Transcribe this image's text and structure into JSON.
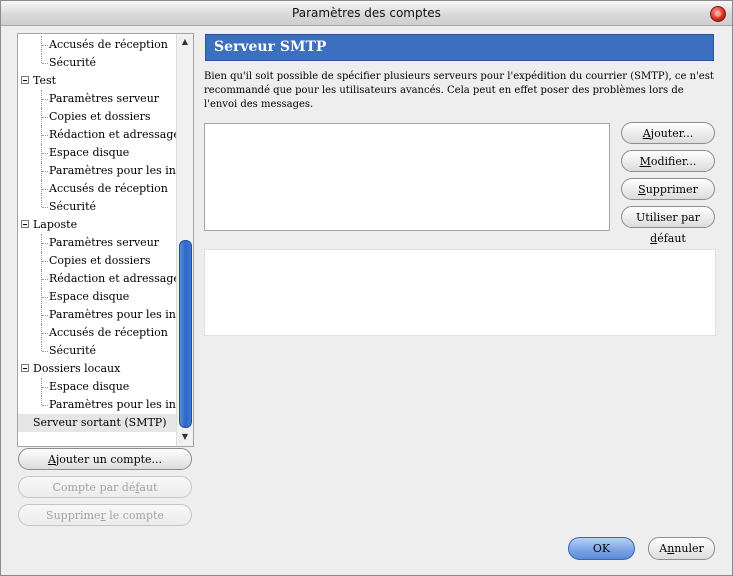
{
  "window": {
    "title": "Paramètres des comptes"
  },
  "tree": {
    "items": [
      {
        "label": "Accusés de réception",
        "level": 1
      },
      {
        "label": "Sécurité",
        "level": 1
      },
      {
        "label": "Test",
        "level": 0
      },
      {
        "label": "Paramètres serveur",
        "level": 1
      },
      {
        "label": "Copies et dossiers",
        "level": 1
      },
      {
        "label": "Rédaction et adressage",
        "level": 1
      },
      {
        "label": "Espace disque",
        "level": 1
      },
      {
        "label": "Paramètres pour les indé...",
        "level": 1
      },
      {
        "label": "Accusés de réception",
        "level": 1
      },
      {
        "label": "Sécurité",
        "level": 1
      },
      {
        "label": "Laposte",
        "level": 0
      },
      {
        "label": "Paramètres serveur",
        "level": 1
      },
      {
        "label": "Copies et dossiers",
        "level": 1
      },
      {
        "label": "Rédaction et adressage",
        "level": 1
      },
      {
        "label": "Espace disque",
        "level": 1
      },
      {
        "label": "Paramètres pour les indé...",
        "level": 1
      },
      {
        "label": "Accusés de réception",
        "level": 1
      },
      {
        "label": "Sécurité",
        "level": 1
      },
      {
        "label": "Dossiers locaux",
        "level": 0
      },
      {
        "label": "Espace disque",
        "level": 1
      },
      {
        "label": "Paramètres pour les indé...",
        "level": 1
      },
      {
        "label": "Serveur sortant (SMTP)",
        "level": 0,
        "selected": true
      }
    ]
  },
  "left_buttons": {
    "add_account": {
      "pre": "",
      "key": "A",
      "post": "jouter un compte..."
    },
    "default_account": {
      "pre": "Compte par dé",
      "key": "f",
      "post": "aut"
    },
    "delete_account": {
      "pre": "Supprime",
      "key": "r",
      "post": " le compte"
    }
  },
  "main": {
    "section_title": "Serveur SMTP",
    "description": "Bien qu'il soit possible de spécifier plusieurs serveurs pour l'expédition du courrier (SMTP), ce n'est recommandé que pour les utilisateurs avancés. Cela peut en effet poser des problèmes lors de l'envoi des messages."
  },
  "right_buttons": {
    "add": {
      "pre": "",
      "key": "A",
      "post": "jouter..."
    },
    "modify": {
      "pre": "",
      "key": "M",
      "post": "odifier..."
    },
    "delete": {
      "pre": "",
      "key": "S",
      "post": "upprimer"
    },
    "set_default": {
      "pre": "Utiliser par ",
      "key": "d",
      "post": "éfaut"
    }
  },
  "footer": {
    "ok": "OK",
    "cancel": {
      "pre": "A",
      "key": "n",
      "post": "nuler"
    }
  },
  "colors": {
    "header_blue": "#3c6fc0",
    "scroll_thumb": "#2c66c8",
    "ok_button": "#7ea6e6"
  },
  "icons": {
    "close": "close-icon",
    "expand": "minus-box-icon",
    "scroll_up": "arrow-up-icon",
    "scroll_down": "arrow-down-icon"
  }
}
